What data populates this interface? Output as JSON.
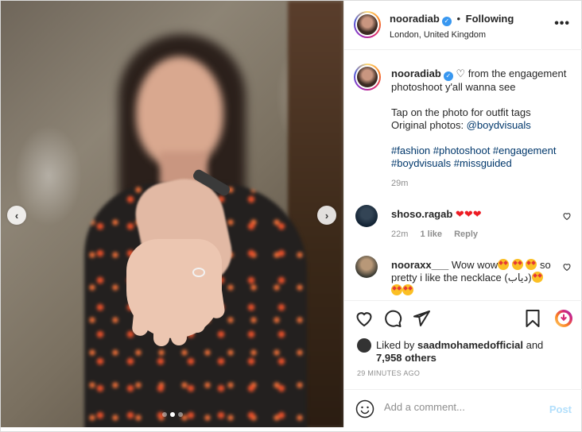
{
  "post": {
    "username": "nooradiab",
    "following_label": "Following",
    "location": "London, United Kingdom",
    "more_label": "•••",
    "bullet": "•"
  },
  "caption": {
    "username": "nooradiab",
    "line1": "♡ from the engagement photoshoot y'all wanna see",
    "line2a": "Tap on the photo for outfit tags",
    "line2b_prefix": "Original photos: ",
    "mention": "@boydvisuals",
    "hashtags_line1": "#fashion #photoshoot #engagement",
    "hashtags_line2": "#boydvisuals #missguided",
    "time": "29m"
  },
  "comments": [
    {
      "username": "shoso.ragab",
      "text": "❤❤❤",
      "time": "22m",
      "likes": "1 like",
      "reply": "Reply"
    },
    {
      "username": "nooraxx___",
      "text_before": "Wow wow",
      "text_after": "so pretty i like the necklace (دياب)"
    }
  ],
  "liked_by": {
    "prefix": "Liked by ",
    "user": "saadmohamedofficial",
    "and": " and",
    "others": "7,958 others"
  },
  "timestamp": "29 MINUTES AGO",
  "comment_box": {
    "placeholder": "Add a comment...",
    "post_label": "Post"
  },
  "carousel": {
    "prev": "‹",
    "next": "›",
    "slide_count": 3,
    "active_index": 1
  },
  "colors": {
    "verified": "#3897f0",
    "link": "#00376b",
    "post_button": "#b2dffc",
    "heart": "#ed1c24"
  },
  "icons": [
    "heart-icon",
    "comment-icon",
    "share-icon",
    "bookmark-icon",
    "save-circle-icon",
    "emoji-icon",
    "verified-icon"
  ]
}
